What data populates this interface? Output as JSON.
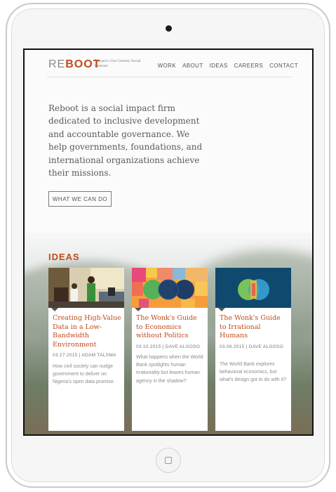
{
  "site": {
    "logo_prefix": "RE",
    "logo_brand": "BOOT",
    "tagline": "Toward a 21st Century Social Contract"
  },
  "nav": [
    "WORK",
    "ABOUT",
    "IDEAS",
    "CAREERS",
    "CONTACT"
  ],
  "intro": {
    "text": "Reboot is a social impact firm dedicated to inclusive development and accountable governance. We help governments, foundations, and international organizations achieve their missions.",
    "button": "WHAT WE CAN DO"
  },
  "ideas": {
    "title": "IDEAS",
    "cards": [
      {
        "title": "Creating High-Value Data in a Low-Bandwidth Environment",
        "meta": "03.27.2015 | ADAM TALSMA",
        "excerpt": "How civil society can nudge government to deliver on Nigeria's open data promise."
      },
      {
        "title": "The Wonk's Guide to Economics without Politics",
        "meta": "03.10.2015 | DAVE ALGOSO",
        "excerpt": "What happens when the World Bank spotlights human irrationality but leaves human agency in the shadow?"
      },
      {
        "title": "The Wonk's Guide to Irrational Humans",
        "meta": "03.06.2015 | DAVE ALGOSO",
        "excerpt": "The World Bank explores behavioral economics, but what's design got to do with it?"
      }
    ]
  },
  "colors": {
    "brand": "#c24a1b",
    "text": "#5a5a5a"
  }
}
